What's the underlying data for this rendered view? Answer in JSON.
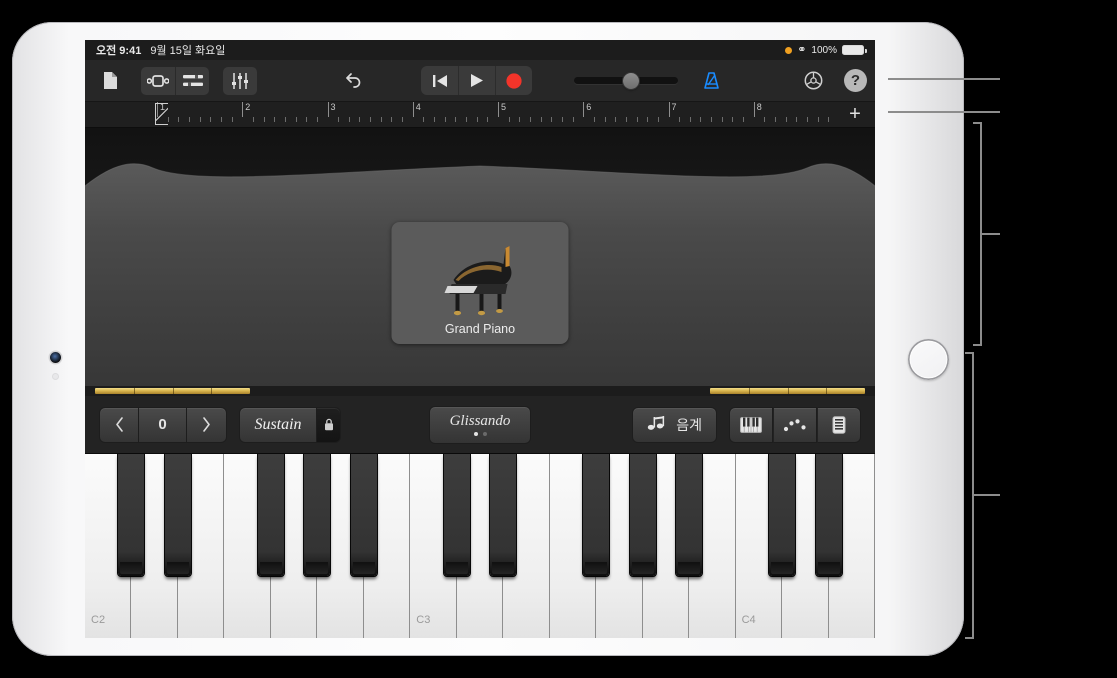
{
  "status_bar": {
    "time": "오전 9:41",
    "date": "9월 15일 화요일",
    "battery_percent": "100%",
    "recording_indicator": "orange-dot",
    "wifi_icon": "wifi-icon",
    "battery_icon": "battery-icon"
  },
  "toolbar": {
    "browser_icon": "document-icon",
    "instrument_icon": "instrument-view-icon",
    "tracks_icon": "tracks-view-icon",
    "fx_icon": "fx-sliders-icon",
    "undo_icon": "undo-icon",
    "rewind_icon": "rewind-icon",
    "play_icon": "play-icon",
    "record_icon": "record-icon",
    "metronome_icon": "metronome-icon",
    "settings_icon": "gear-icon",
    "help_label": "?",
    "volume_value": 55,
    "record_color": "#f3342a",
    "metronome_color": "#1a8cff"
  },
  "ruler": {
    "bars": [
      "1",
      "2",
      "3",
      "4",
      "5",
      "6",
      "7",
      "8"
    ],
    "playhead_bar": "1",
    "add_section_label": "+"
  },
  "instrument": {
    "name": "Grand Piano",
    "art": "grand-piano-image"
  },
  "controls": {
    "octave_value": "0",
    "octave_down_icon": "chevron-left-icon",
    "octave_up_icon": "chevron-right-icon",
    "sustain_label": "Sustain",
    "sustain_lock_icon": "lock-icon",
    "glissando_label": "Glissando",
    "glissando_page": 1,
    "glissando_pages": 2,
    "scale_label": "음계",
    "scale_icon": "double-note-icon",
    "keyboard_icon": "keyboard-icon",
    "arpeggiator_icon": "arpeggiator-icon",
    "chord_strip_icon": "chord-strip-icon"
  },
  "keyboard": {
    "octave_labels": [
      "C2",
      "C3",
      "C4"
    ],
    "white_key_count": 17,
    "label_positions": [
      0,
      7,
      14
    ]
  },
  "callouts": {
    "count": 4,
    "line_color": "#8c8c8c"
  }
}
